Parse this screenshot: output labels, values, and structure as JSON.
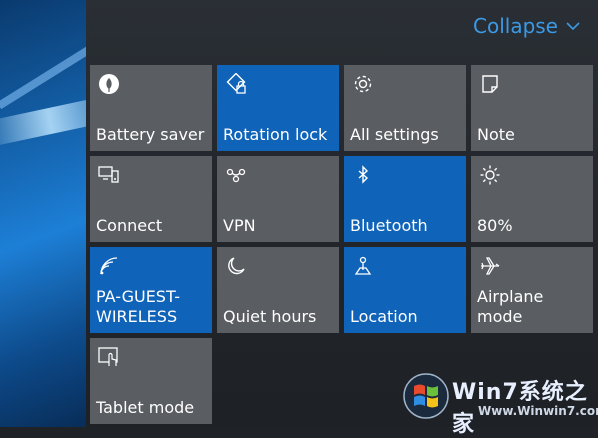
{
  "header": {
    "collapse_label": "Collapse"
  },
  "tiles": [
    {
      "name": "battery-saver",
      "label": "Battery saver",
      "active": false,
      "icon": "leaf-icon"
    },
    {
      "name": "rotation-lock",
      "label": "Rotation lock",
      "active": true,
      "icon": "rotation-lock-icon"
    },
    {
      "name": "all-settings",
      "label": "All settings",
      "active": false,
      "icon": "gear-icon"
    },
    {
      "name": "note",
      "label": "Note",
      "active": false,
      "icon": "note-icon"
    },
    {
      "name": "connect",
      "label": "Connect",
      "active": false,
      "icon": "connect-icon"
    },
    {
      "name": "vpn",
      "label": "VPN",
      "active": false,
      "icon": "vpn-icon"
    },
    {
      "name": "bluetooth",
      "label": "Bluetooth",
      "active": true,
      "icon": "bluetooth-icon"
    },
    {
      "name": "brightness",
      "label": "80%",
      "active": false,
      "icon": "brightness-icon"
    },
    {
      "name": "wifi",
      "label": "PA-GUEST-\nWIRELESS",
      "active": true,
      "icon": "wifi-icon"
    },
    {
      "name": "quiet-hours",
      "label": "Quiet hours",
      "active": false,
      "icon": "moon-icon"
    },
    {
      "name": "location",
      "label": "Location",
      "active": true,
      "icon": "location-icon"
    },
    {
      "name": "airplane-mode",
      "label": "Airplane mode",
      "active": false,
      "icon": "airplane-icon"
    },
    {
      "name": "tablet-mode",
      "label": "Tablet mode",
      "active": false,
      "icon": "tablet-mode-icon"
    }
  ],
  "watermark": {
    "brand": "Win7系统之家",
    "url": "Www.Winwin7.com"
  },
  "colors": {
    "accent": "#0f63b8",
    "tile_off": "#5a5d61",
    "link": "#3b9ae6"
  }
}
